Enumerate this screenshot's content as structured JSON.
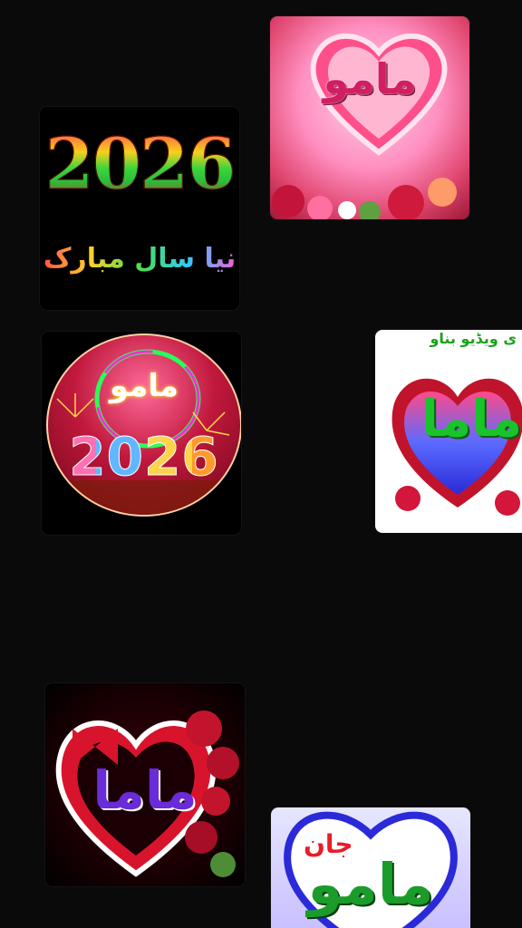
{
  "tiles": [
    {
      "id": "t1",
      "text": "مامو",
      "icon": "heart-roses"
    },
    {
      "id": "t2",
      "year": "2026",
      "greeting": "نیا سال مبارک"
    },
    {
      "id": "t3",
      "text": "مامو",
      "year": "2026",
      "icon": "fireworks-circle"
    },
    {
      "id": "t4",
      "banner": "ی ویڈیو بناو",
      "text": "ماما",
      "icon": "blue-heart-roses"
    },
    {
      "id": "t5",
      "text": "ماما",
      "icon": "red-heart-roses"
    },
    {
      "id": "t6",
      "prefix": "جان",
      "text": "مامو",
      "icon": "heart-pearls"
    }
  ],
  "colors": {
    "background": "#0a0a0a"
  }
}
